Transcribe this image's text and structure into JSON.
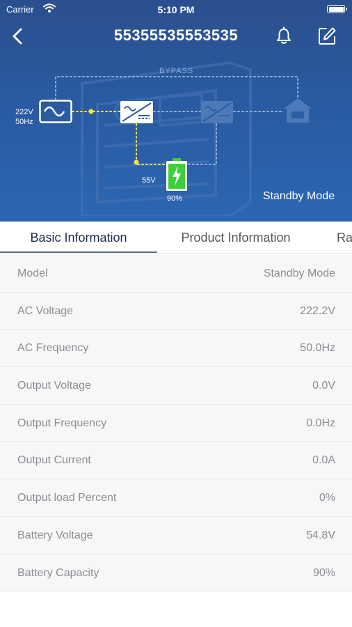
{
  "status_bar": {
    "carrier": "Carrier",
    "time": "5:10 PM"
  },
  "nav": {
    "title": "55355535553535"
  },
  "diagram": {
    "bypass_label": "BYPASS",
    "ac_input": {
      "voltage": "222V",
      "frequency": "50Hz"
    },
    "battery": {
      "voltage": "55V",
      "percent": "90%",
      "level": 0.9
    },
    "mode": "Standby Mode",
    "colors": {
      "active_line": "#f5e94a",
      "inactive_line": "#8fb0dd",
      "battery_green": "#3fcf3a"
    }
  },
  "tabs": [
    {
      "label": "Basic Information",
      "active": true
    },
    {
      "label": "Product Information",
      "active": false
    },
    {
      "label": "Ra",
      "active": false
    }
  ],
  "rows": [
    {
      "label": "Model",
      "value": "Standby Mode"
    },
    {
      "label": "AC Voltage",
      "value": "222.2V"
    },
    {
      "label": "AC Frequency",
      "value": "50.0Hz"
    },
    {
      "label": "Output Voltage",
      "value": "0.0V"
    },
    {
      "label": "Output Frequency",
      "value": "0.0Hz"
    },
    {
      "label": "Output Current",
      "value": "0.0A"
    },
    {
      "label": "Output load Percent",
      "value": "0%"
    },
    {
      "label": "Battery Voltage",
      "value": "54.8V"
    },
    {
      "label": "Battery Capacity",
      "value": "90%"
    }
  ]
}
